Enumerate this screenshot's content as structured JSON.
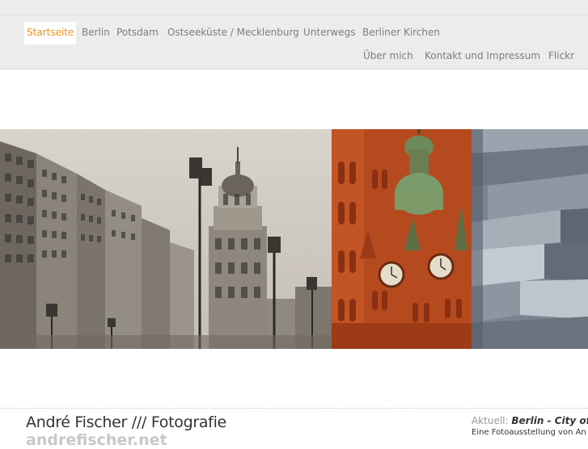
{
  "nav": {
    "row1": [
      "Startseite",
      "Berlin",
      "Potsdam",
      "Ostseeküste / Mecklenburg",
      "Unterwegs",
      "Berliner Kirchen"
    ],
    "row2": [
      "Über mich",
      "Kontakt und Impressum",
      "Flickr"
    ],
    "active_color": "#e8931f"
  },
  "gallery": {
    "photos": [
      "frankfurter-tor-photo",
      "red-brick-church-photo",
      "memorial-stelae-photo"
    ]
  },
  "footer": {
    "brand": "André Fischer /// Fotografie",
    "domain": "andrefischer.net",
    "news_label": "Aktuell:",
    "news_title": "Berlin - City of L",
    "news_sub": "Eine Fotoausstellung von An"
  }
}
